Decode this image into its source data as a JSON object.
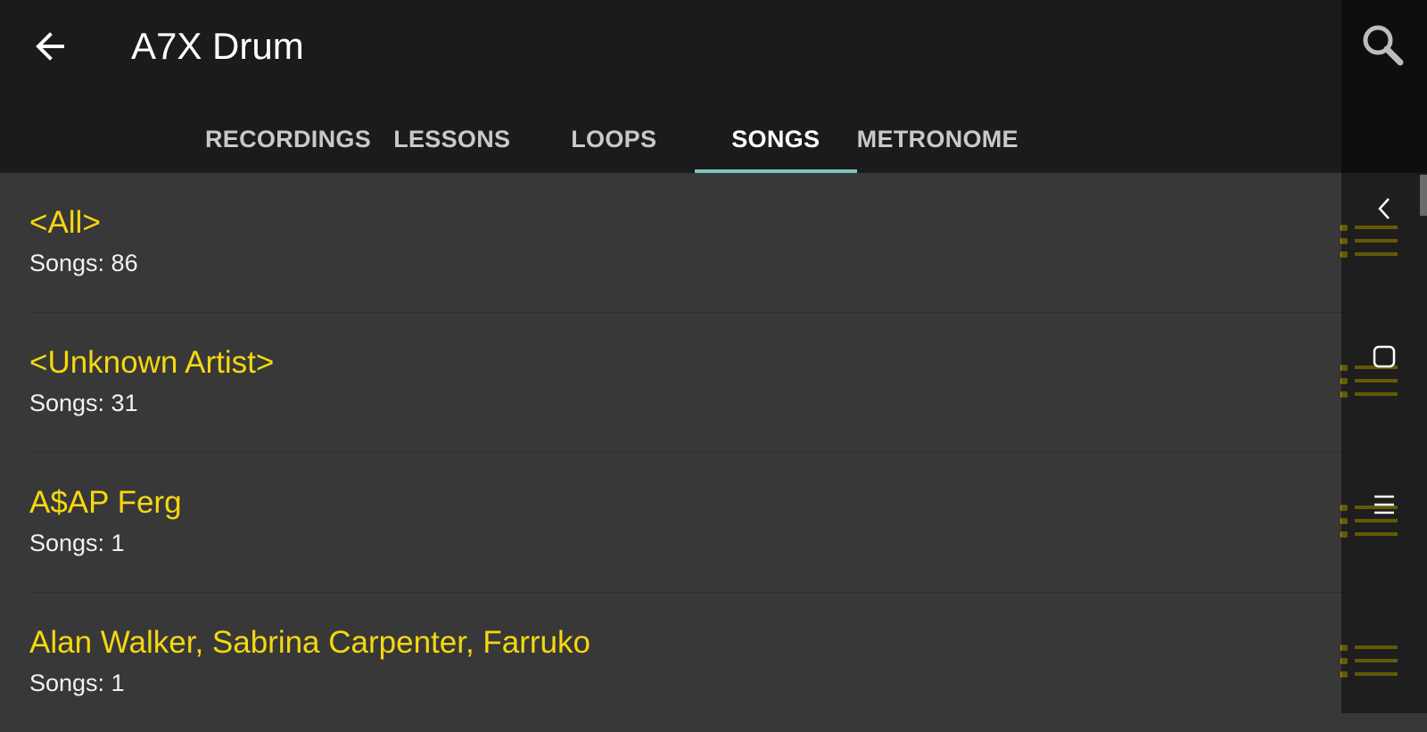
{
  "appbar": {
    "title": "A7X Drum",
    "back_icon": "arrow-left-icon",
    "search_icon": "search-icon"
  },
  "tabs": [
    {
      "label": "RECORDINGS",
      "active": false
    },
    {
      "label": "LESSONS",
      "active": false
    },
    {
      "label": "LOOPS",
      "active": false
    },
    {
      "label": "SONGS",
      "active": true
    },
    {
      "label": "METRONOME",
      "active": false
    }
  ],
  "artists": [
    {
      "name": "<All>",
      "songs": "Songs: 86"
    },
    {
      "name": "<Unknown Artist>",
      "songs": "Songs: 31"
    },
    {
      "name": "A$AP Ferg",
      "songs": "Songs: 1"
    },
    {
      "name": "Alan Walker, Sabrina Carpenter, Farruko",
      "songs": "Songs: 1"
    }
  ],
  "system_nav": {
    "back_icon": "chevron-left-icon",
    "home_icon": "square-icon",
    "recents_icon": "lines-icon"
  },
  "colors": {
    "appbar_bg": "#1b1b1b",
    "list_bg": "#383838",
    "artist_text": "#f5d80f",
    "tab_indicator": "#7ec4c0",
    "row_menu_icon": "#b5a20c"
  }
}
